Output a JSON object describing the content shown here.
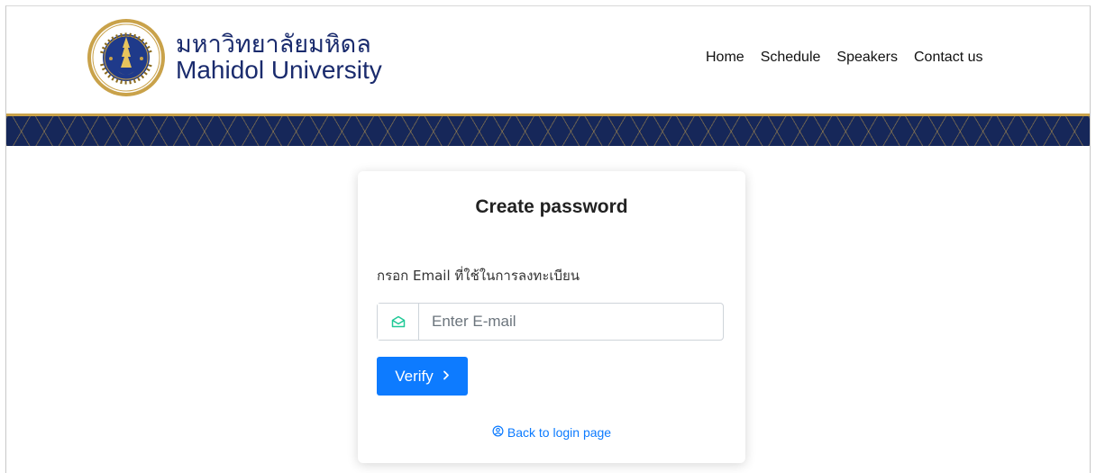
{
  "header": {
    "brand_thai": "มหาวิทยาลัยมหิดล",
    "brand_en": "Mahidol University",
    "logo_text": "มหาวิทยาลัยมหิดล",
    "nav": [
      {
        "label": "Home"
      },
      {
        "label": "Schedule"
      },
      {
        "label": "Speakers"
      },
      {
        "label": "Contact us"
      }
    ]
  },
  "colors": {
    "brand_navy": "#1a2b6d",
    "banner": "#162759",
    "gold": "#c9a24a",
    "primary": "#0d7bff"
  },
  "card": {
    "title": "Create password",
    "label": "กรอก Email ที่ใช้ในการลงทะเบียน",
    "email_placeholder": "Enter E-mail",
    "email_value": "",
    "email_icon": "envelope-open-icon",
    "verify_label": "Verify",
    "verify_icon": "chevron-right-icon",
    "back_link": "Back to login page",
    "back_icon": "user-circle-icon"
  }
}
